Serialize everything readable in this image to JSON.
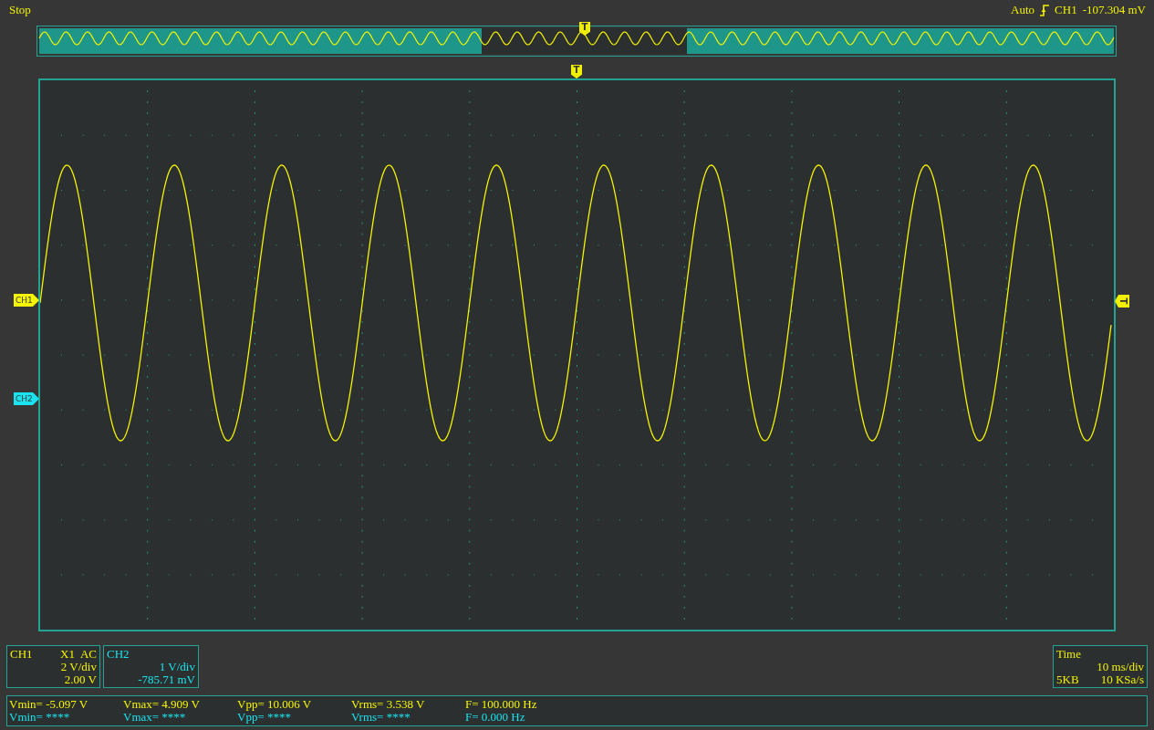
{
  "status": {
    "run_state": "Stop",
    "trigger_mode": "Auto",
    "trigger_source": "CH1",
    "trigger_level": "-107.304 mV"
  },
  "overview": {
    "trigger_marker": "T"
  },
  "display": {
    "trigger_marker": "T",
    "trigger_level_marker": "T",
    "channel_markers": [
      {
        "label": "CH1",
        "color": "#f5f500"
      },
      {
        "label": "CH2",
        "color": "#19e3ee"
      }
    ]
  },
  "channels": [
    {
      "name": "CH1",
      "probe": "X1",
      "coupling": "AC",
      "scale": "2 V/div",
      "offset": "2.00 V",
      "color": "#f5f500"
    },
    {
      "name": "CH2",
      "scale": "1 V/div",
      "offset": "-785.71 mV",
      "color": "#19e3ee"
    }
  ],
  "timebase": {
    "title": "Time",
    "scale": "10 ms/div",
    "memory": "5KB",
    "sample_rate": "10 KSa/s"
  },
  "measurements": [
    {
      "color": "#f5f500",
      "values": [
        "Vmin= -5.097 V",
        "Vmax= 4.909 V",
        "Vpp= 10.006 V",
        "Vrms= 3.538 V",
        "F= 100.000 Hz"
      ]
    },
    {
      "color": "#19e3ee",
      "values": [
        "Vmin= ****",
        "Vmax= ****",
        "Vpp= ****",
        "Vrms= ****",
        "F= 0.000 Hz"
      ]
    }
  ]
}
